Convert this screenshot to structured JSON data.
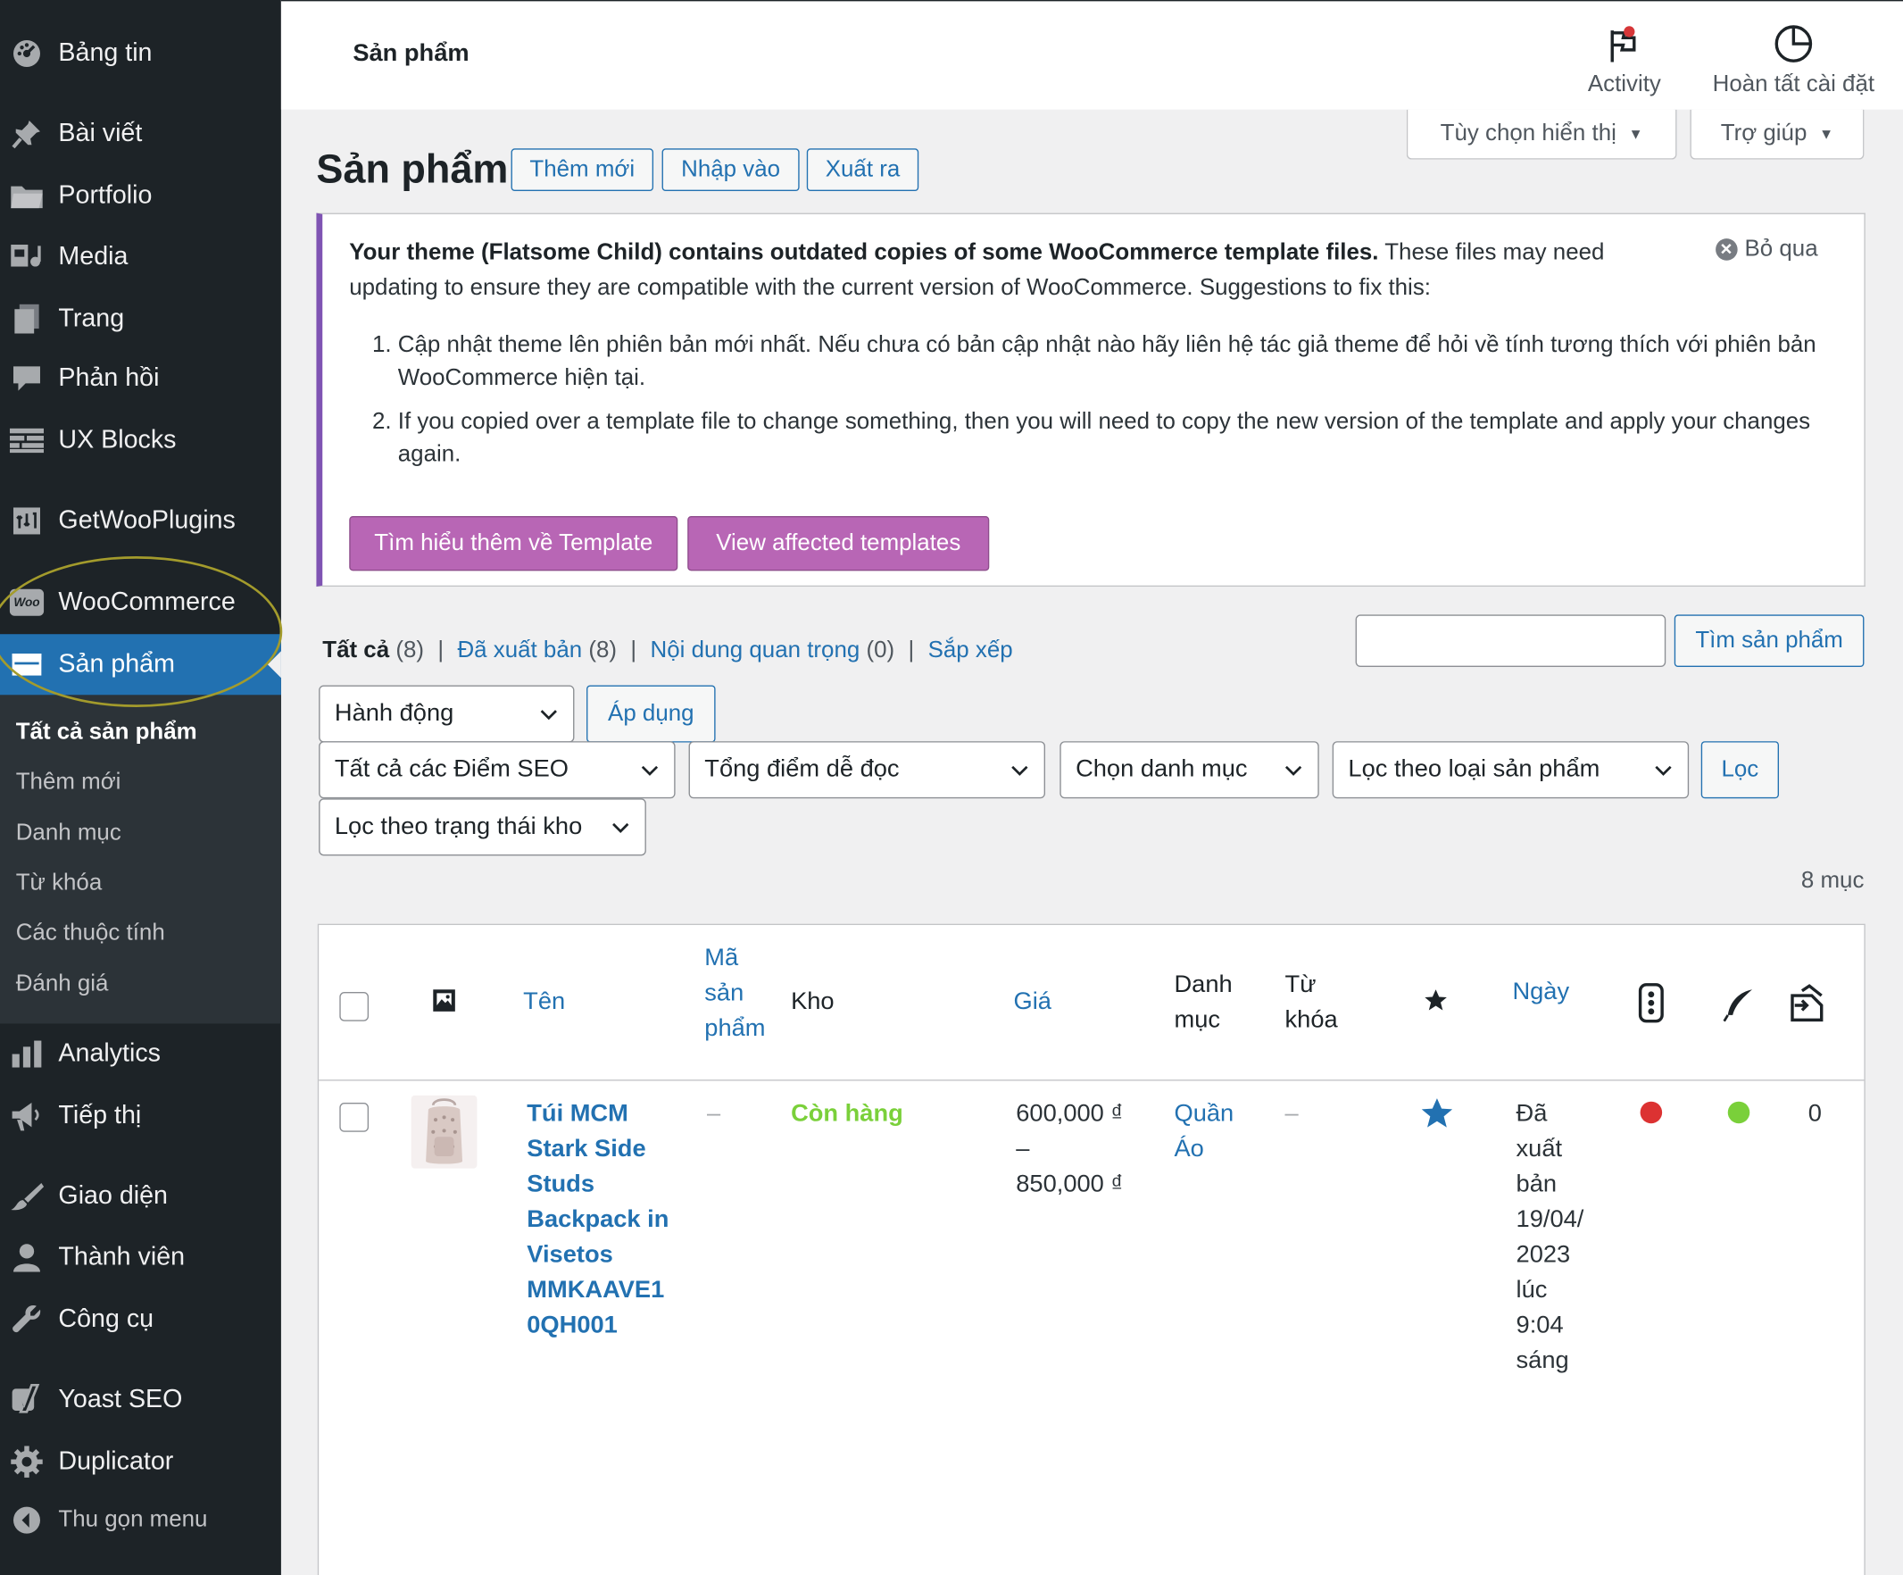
{
  "sidebar": {
    "items": [
      {
        "label": "Bảng tin",
        "icon": "dashboard-icon"
      },
      {
        "label": "Bài viết",
        "icon": "pin-icon"
      },
      {
        "label": "Portfolio",
        "icon": "folder-icon"
      },
      {
        "label": "Media",
        "icon": "media-icon"
      },
      {
        "label": "Trang",
        "icon": "page-icon"
      },
      {
        "label": "Phản hồi",
        "icon": "comment-icon"
      },
      {
        "label": "UX Blocks",
        "icon": "blocks-icon"
      },
      {
        "label": "GetWooPlugins",
        "icon": "plugin-icon"
      },
      {
        "label": "WooCommerce",
        "icon": "woo-icon"
      },
      {
        "label": "Sản phẩm",
        "icon": "product-icon"
      },
      {
        "label": "Analytics",
        "icon": "chart-bar-icon"
      },
      {
        "label": "Tiếp thị",
        "icon": "megaphone-icon"
      },
      {
        "label": "Giao diện",
        "icon": "brush-icon"
      },
      {
        "label": "Thành viên",
        "icon": "user-icon"
      },
      {
        "label": "Công cụ",
        "icon": "wrench-icon"
      },
      {
        "label": "Yoast SEO",
        "icon": "yoast-icon"
      },
      {
        "label": "Duplicator",
        "icon": "gear-icon"
      }
    ],
    "woo_badge": "Woo",
    "submenu": [
      "Tất cả sản phẩm",
      "Thêm mới",
      "Danh mục",
      "Từ khóa",
      "Các thuộc tính",
      "Đánh giá"
    ],
    "collapse_label": "Thu gọn menu"
  },
  "header": {
    "page_name": "Sản phẩm",
    "activity_label": "Activity",
    "setup_label": "Hoàn tất cài đặt"
  },
  "screen_tabs": {
    "options_label": "Tùy chọn hiển thị",
    "help_label": "Trợ giúp"
  },
  "title_row": {
    "title": "Sản phẩm",
    "add_new": "Thêm mới",
    "import": "Nhập vào",
    "export": "Xuất ra"
  },
  "notice": {
    "bold_text": "Your theme (Flatsome Child) contains outdated copies of some WooCommerce template files.",
    "text": " These files may need updating to ensure they are compatible with the current version of WooCommerce. Suggestions to fix this:",
    "dismiss": "Bỏ qua",
    "steps": [
      "Cập nhật theme lên phiên bản mới nhất. Nếu chưa có bản cập nhật nào hãy liên hệ tác giả theme để hỏi về tính tương thích với phiên bản WooCommerce hiện tại.",
      "If you copied over a template file to change something, then you will need to copy the new version of the template and apply your changes again."
    ],
    "btn_learn": "Tìm hiểu thêm về Template",
    "btn_view": "View affected templates"
  },
  "views": {
    "all": "Tất cả",
    "all_count": "(8)",
    "published": "Đã xuất bản",
    "published_count": "(8)",
    "cornerstone": "Nội dung quan trọng",
    "cornerstone_count": "(0)",
    "sort": "Sắp xếp"
  },
  "search": {
    "value": "",
    "button": "Tìm sản phẩm"
  },
  "filters": {
    "bulk_action": "Hành động",
    "apply": "Áp dụng",
    "seo": "Tất cả các Điểm SEO",
    "readability": "Tổng điểm dễ đọc",
    "category": "Chọn danh mục",
    "product_type": "Lọc theo loại sản phẩm",
    "filter_btn": "Lọc",
    "stock_status": "Lọc theo trạng thái kho"
  },
  "items_count": "8 mục",
  "table": {
    "headers": {
      "name": "Tên",
      "sku": "Mã sản phẩm",
      "stock": "Kho",
      "price": "Giá",
      "category": "Danh mục",
      "tags": "Từ khóa",
      "date": "Ngày"
    },
    "rows": [
      {
        "name": "Túi MCM Stark Side Studs Backpack in Visetos MMKAAVE1 0QH001",
        "sku": "–",
        "stock": "Còn hàng",
        "price_low": "600,000 ₫",
        "price_sep": "–",
        "price_high": "850,000 ₫",
        "category": "Quần Áo",
        "tags": "–",
        "date": "Đã xuất bản 19/04/ 2023 lúc 9:04 sáng",
        "comments": "0",
        "seo_color": "#dc3232",
        "readability_color": "#7ad03a"
      }
    ]
  }
}
